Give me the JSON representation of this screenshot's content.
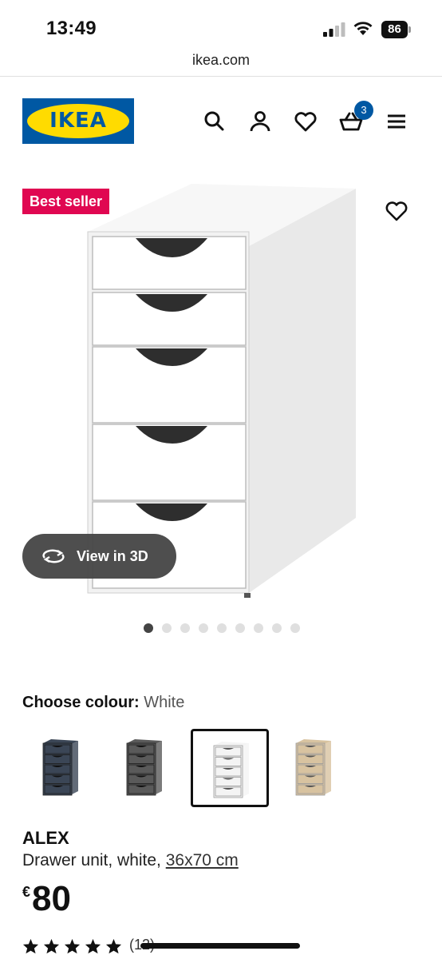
{
  "status_bar": {
    "time": "13:49",
    "battery": "86"
  },
  "browser": {
    "url": "ikea.com"
  },
  "header": {
    "logo_text": "IKEA",
    "cart_count": "3"
  },
  "gallery": {
    "badge": "Best seller",
    "view_3d_label": "View in 3D",
    "dot_count": 9,
    "active_dot": 0
  },
  "colour_chooser": {
    "label": "Choose colour:",
    "selected": "White",
    "options": [
      {
        "name": "blue",
        "color": "#3b4656",
        "selected": false
      },
      {
        "name": "grey",
        "color": "#5a5a5a",
        "selected": false
      },
      {
        "name": "white",
        "color": "#f4f4f4",
        "selected": true
      },
      {
        "name": "oak",
        "color": "#d8c3a0",
        "selected": false
      }
    ]
  },
  "product": {
    "name": "ALEX",
    "description": "Drawer unit, white, ",
    "size": "36x70 cm",
    "currency": "€",
    "price": "80",
    "rating_stars": 5,
    "rating_count": "(12)"
  },
  "colors": {
    "brand_blue": "#0058a3",
    "brand_yellow": "#ffdb00",
    "badge_red": "#e00751"
  }
}
